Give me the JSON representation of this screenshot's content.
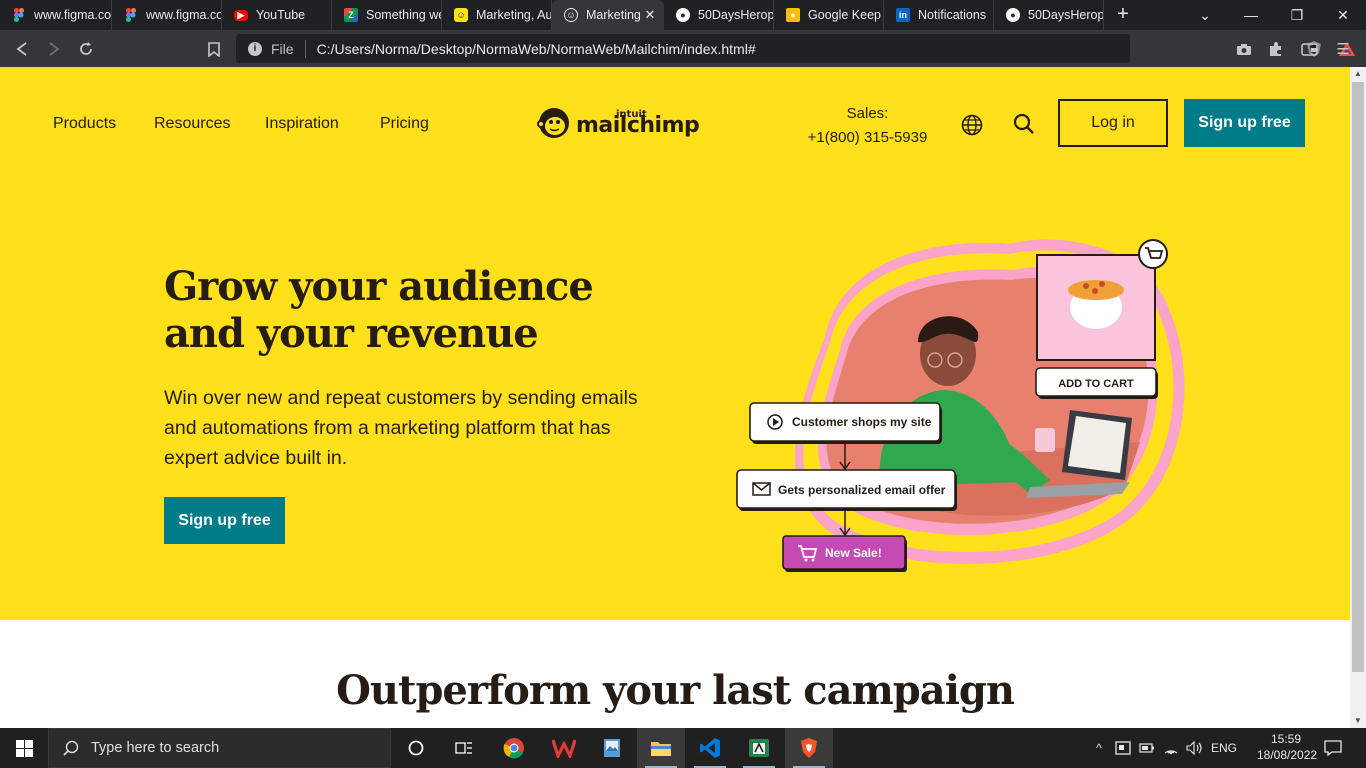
{
  "browser": {
    "tabs": [
      {
        "title": "www.figma.co",
        "icon": "figma-icon",
        "color": "#f24e1e"
      },
      {
        "title": "www.figma.co",
        "icon": "figma-icon",
        "color": "#f24e1e"
      },
      {
        "title": "YouTube",
        "icon": "youtube-icon",
        "color": "#ff0000"
      },
      {
        "title": "Something we",
        "icon": "zoho-icon",
        "color": "#f0483e"
      },
      {
        "title": "Marketing, Au",
        "icon": "mailchimp-icon",
        "color": "#ffe01b"
      },
      {
        "title": "Marketing",
        "icon": "mailchimp-icon",
        "color": "#ffe01b",
        "active": true
      },
      {
        "title": "50DaysHerop",
        "icon": "github-icon",
        "color": "#ffffff"
      },
      {
        "title": "Google Keep",
        "icon": "keep-icon",
        "color": "#fbbc04"
      },
      {
        "title": "Notifications",
        "icon": "linkedin-icon",
        "color": "#0a66c2"
      },
      {
        "title": "50DaysHerop",
        "icon": "github-icon",
        "color": "#ffffff"
      }
    ],
    "address": {
      "scheme_label": "File",
      "url": "C:/Users/Norma/Desktop/NormaWeb/NormaWeb/Mailchim/index.html#"
    }
  },
  "nav": {
    "links": [
      "Products",
      "Resources",
      "Inspiration",
      "Pricing"
    ],
    "logo_intuit": "intuit",
    "logo_text": "mailchimp",
    "sales_label": "Sales:",
    "sales_phone": "+1(800) 315-5939",
    "login_label": "Log in",
    "signup_label": "Sign up free"
  },
  "hero": {
    "headline_line1": "Grow your audience",
    "headline_line2": "and your revenue",
    "subtext": "Win over new and repeat customers by sending emails and automations from a marketing platform that has expert advice built in.",
    "cta_label": "Sign up free",
    "illustration": {
      "add_to_cart": "ADD TO CART",
      "step1": "Customer shops my site",
      "step2": "Gets personalized email offer",
      "step3": "New Sale!"
    }
  },
  "section2": {
    "title": "Outperform your last campaign"
  },
  "taskbar": {
    "search_placeholder": "Type here to search",
    "lang": "ENG",
    "time": "15:59",
    "date": "18/08/2022"
  },
  "colors": {
    "brand_yellow": "#ffe01b",
    "brand_teal": "#007c89",
    "text_dark": "#241c15"
  }
}
